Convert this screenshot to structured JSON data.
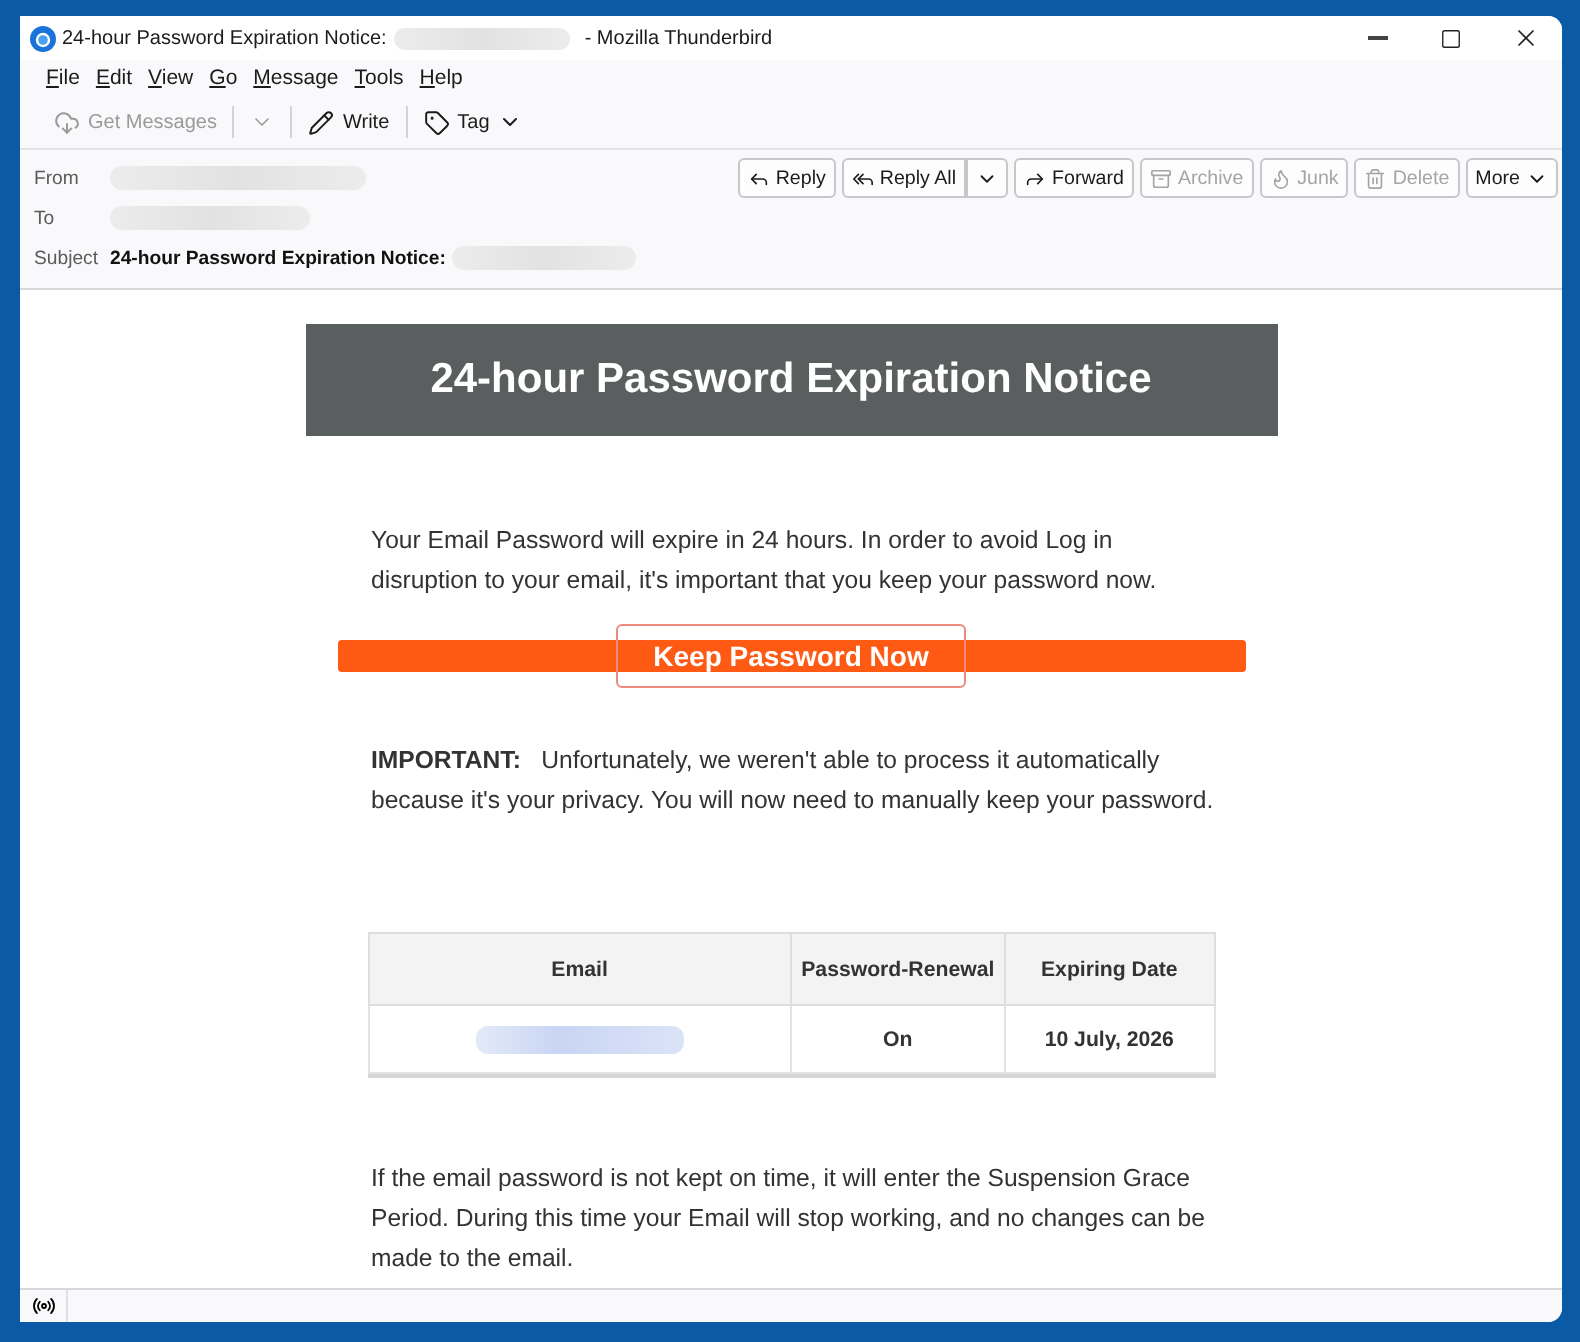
{
  "window": {
    "title": "24-hour Password Expiration Notice:",
    "title_redacted": true,
    "app_name": "- Mozilla Thunderbird"
  },
  "menu_bar": [
    {
      "label": "File"
    },
    {
      "label": "Edit"
    },
    {
      "label": "View"
    },
    {
      "label": "Go"
    },
    {
      "label": "Message"
    },
    {
      "label": "Tools"
    },
    {
      "label": "Help"
    }
  ],
  "toolbar": [
    {
      "kind": "split",
      "label": "Get Messages",
      "disabled": true
    },
    {
      "kind": "button",
      "label": "Write",
      "disabled": false
    },
    {
      "kind": "menu",
      "label": "Tag",
      "disabled": false
    }
  ],
  "header": {
    "fields": [
      {
        "kind": "address",
        "label": "From",
        "redacted": true
      },
      {
        "kind": "address",
        "label": "To",
        "redacted": true
      },
      {
        "kind": "subject",
        "label": "Subject",
        "value": "24-hour Password Expiration Notice:",
        "redacted": true
      }
    ],
    "actions": [
      {
        "kind": "button",
        "label": "Reply",
        "disabled": false
      },
      {
        "kind": "split",
        "label": "Reply All",
        "disabled": false
      },
      {
        "kind": "button",
        "label": "Forward",
        "disabled": false
      },
      {
        "kind": "button",
        "label": "Archive",
        "disabled": true
      },
      {
        "kind": "button",
        "label": "Junk",
        "disabled": true
      },
      {
        "kind": "button",
        "label": "Delete",
        "disabled": true
      },
      {
        "kind": "menu",
        "label": "More",
        "disabled": false
      }
    ]
  },
  "message": {
    "banner": "24-hour Password Expiration Notice",
    "intro": "Your Email Password will expire in 24 hours. In order to avoid Log in disruption to your email, it's important that you keep your password now.",
    "button": "Keep Password Now",
    "important": "**IMPORTANT:**   Unfortunately, we weren't able to process it automatically because it's your privacy. You will now need to manually keep your password.",
    "table": {
      "columns": [
        "Email",
        "Password-Renewal",
        "Expiring Date"
      ],
      "rows": [
        {
          "cells": [
            {
              "kind": "redacted"
            },
            {
              "kind": "text",
              "text": "On"
            },
            {
              "kind": "text",
              "text": "10 July, 2026"
            }
          ]
        }
      ]
    },
    "closing": "If the email password is not kept on time, it will enter the Suspension Grace Period. During this time your Email will stop working, and no changes can be made to the email."
  }
}
